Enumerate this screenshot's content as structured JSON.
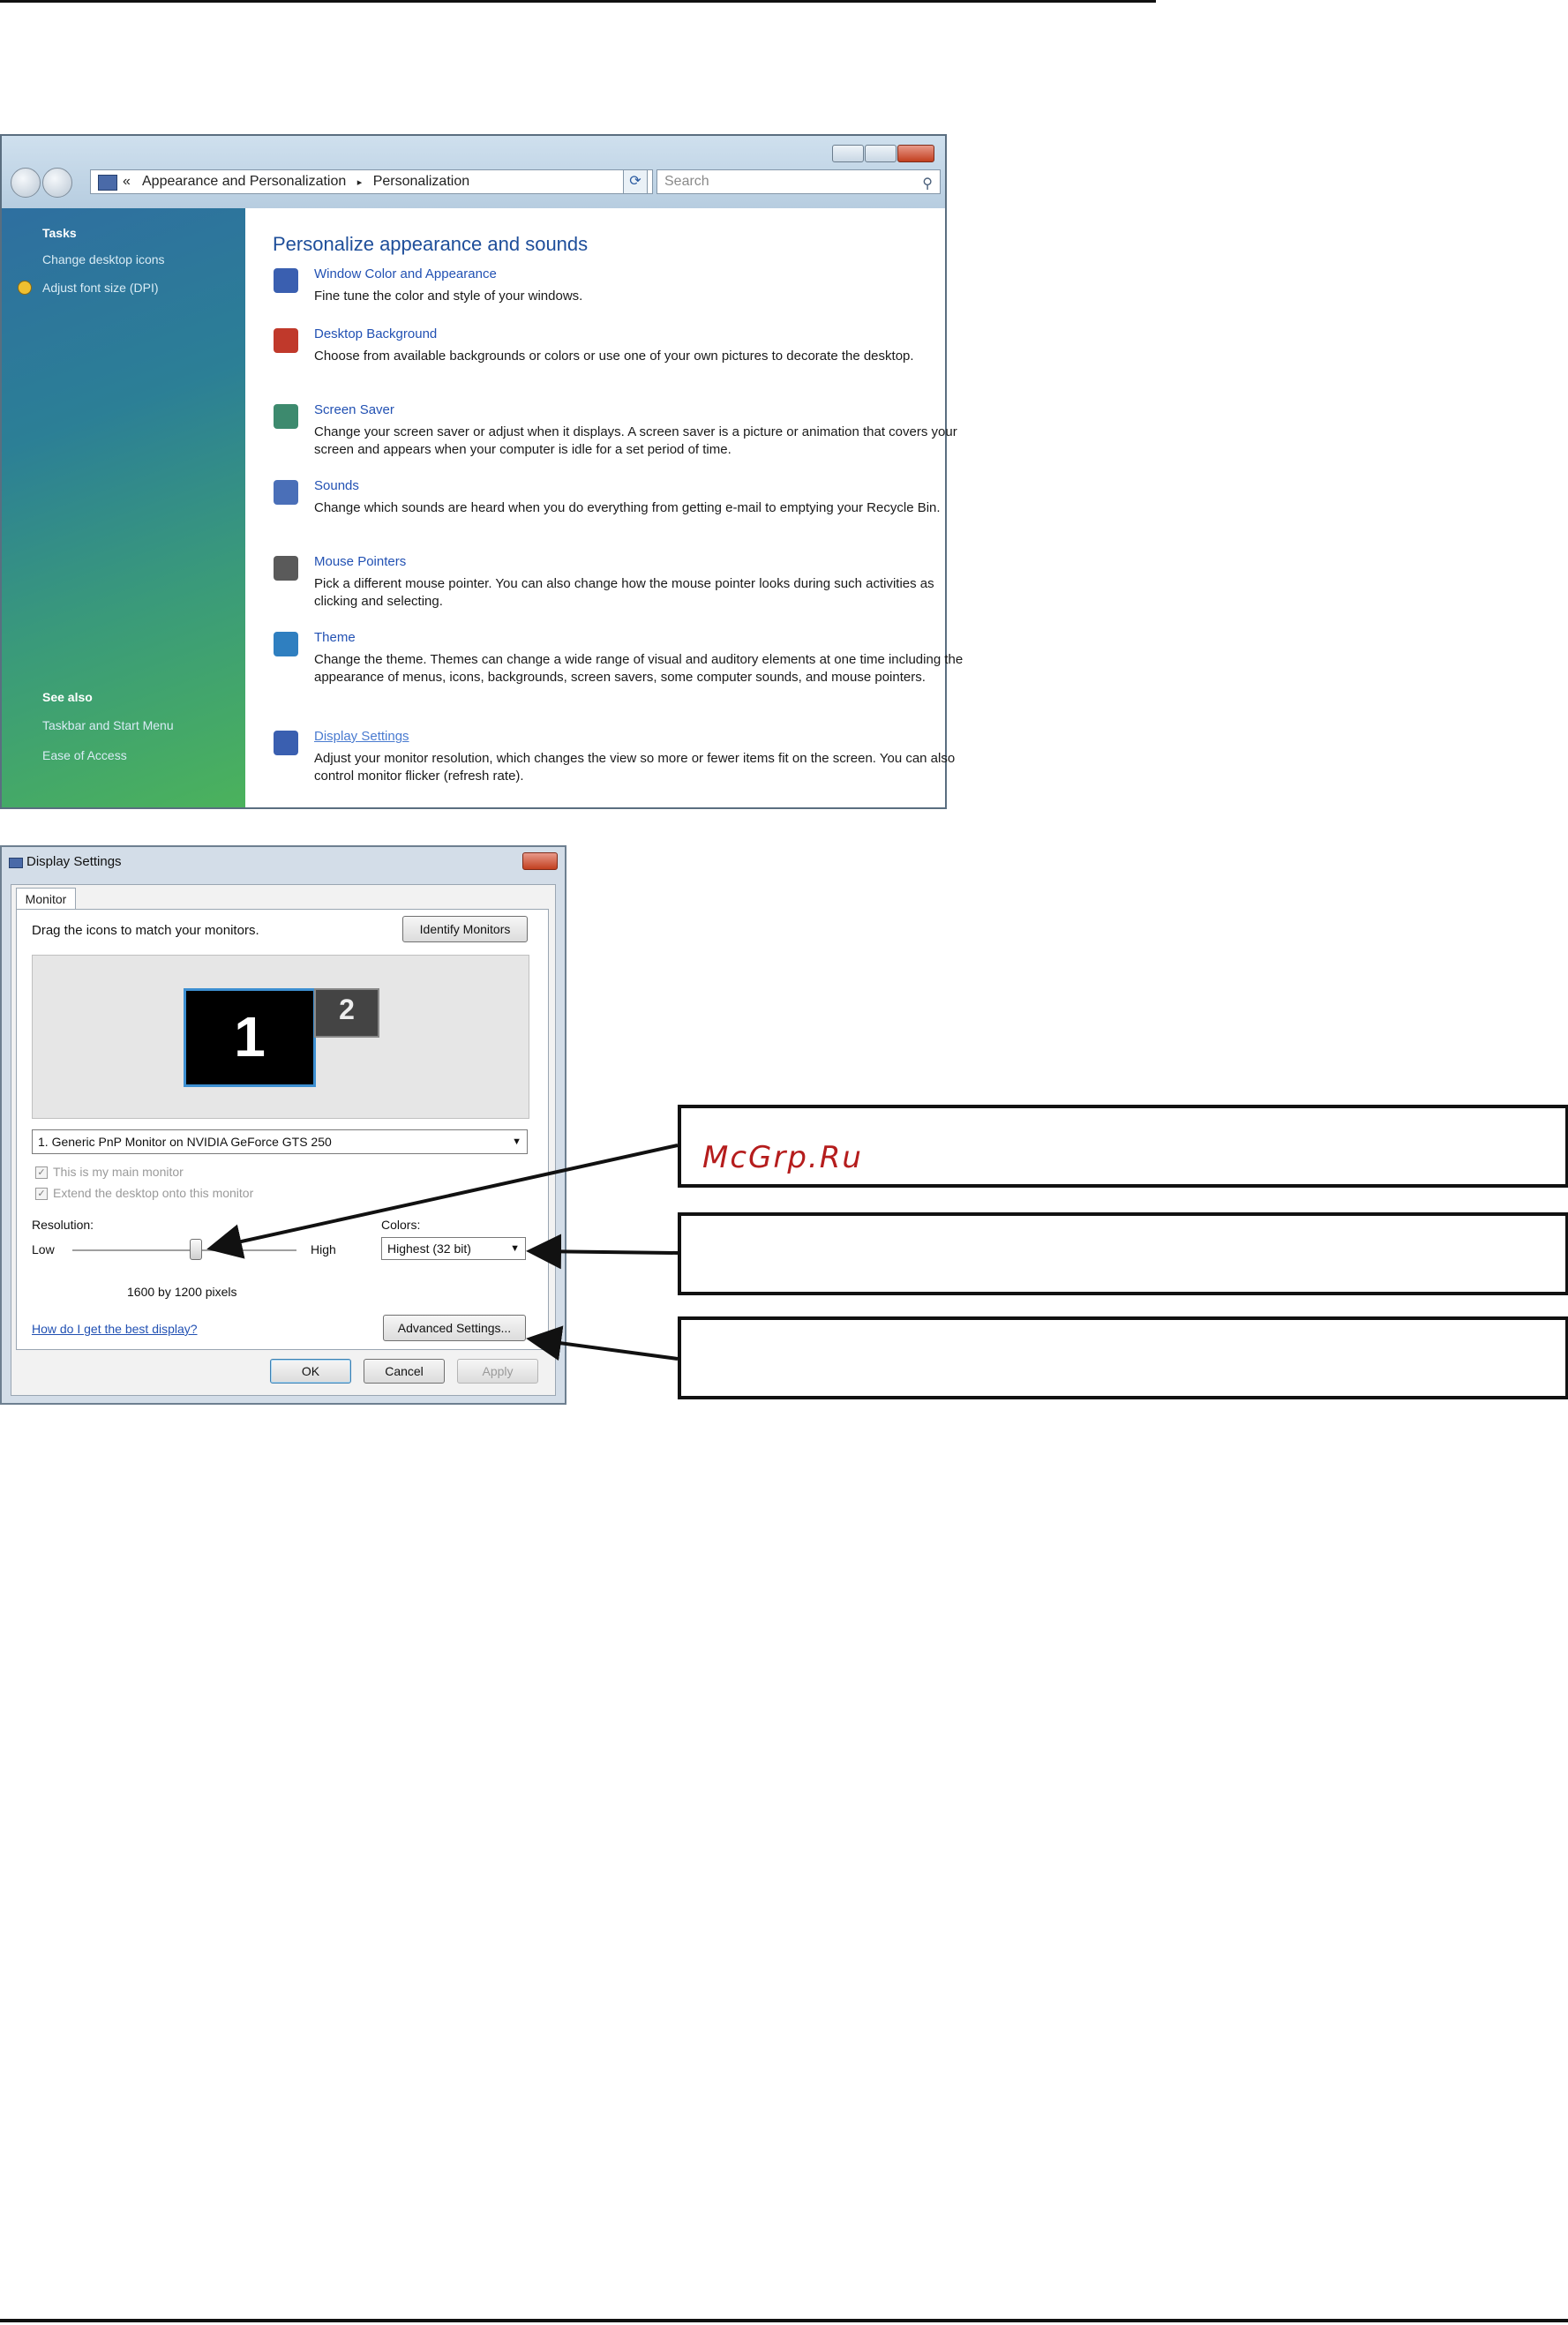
{
  "personalization_window": {
    "breadcrumb": {
      "prefix": "«",
      "parent": "Appearance and Personalization",
      "separator": "▸",
      "current": "Personalization"
    },
    "search_placeholder": "Search",
    "left_pane": {
      "tasks_heading": "Tasks",
      "tasks": [
        "Change desktop icons",
        "Adjust font size (DPI)"
      ],
      "see_also_heading": "See also",
      "see_also": [
        "Taskbar and Start Menu",
        "Ease of Access"
      ]
    },
    "main_title": "Personalize appearance and sounds",
    "items": [
      {
        "title": "Window Color and Appearance",
        "desc": "Fine tune the color and style of your windows."
      },
      {
        "title": "Desktop Background",
        "desc": "Choose from available backgrounds or colors or use one of your own pictures to decorate the desktop."
      },
      {
        "title": "Screen Saver",
        "desc": "Change your screen saver or adjust when it displays. A screen saver is a picture or animation that covers your screen and appears when your computer is idle for a set period of time."
      },
      {
        "title": "Sounds",
        "desc": "Change which sounds are heard when you do everything from getting e-mail to emptying your Recycle Bin."
      },
      {
        "title": "Mouse Pointers",
        "desc": "Pick a different mouse pointer. You can also change how the mouse pointer looks during such activities as clicking and selecting."
      },
      {
        "title": "Theme",
        "desc": "Change the theme. Themes can change a wide range of visual and auditory elements at one time including the appearance of menus, icons, backgrounds, screen savers, some computer sounds, and mouse pointers."
      },
      {
        "title": "Display Settings",
        "desc": "Adjust your monitor resolution, which changes the view so more or fewer items fit on the screen. You can also control monitor flicker (refresh rate)."
      }
    ],
    "icon_colors": [
      "#3a5fb0",
      "#c0392b",
      "#3d8a6e",
      "#4a6fb8",
      "#5a5a5a",
      "#2f7fc0",
      "#3a5fb0"
    ]
  },
  "display_settings": {
    "title": "Display Settings",
    "tab": "Monitor",
    "instruction": "Drag the icons to match your monitors.",
    "identify_button": "Identify Monitors",
    "monitor_1": "1",
    "monitor_2": "2",
    "monitor_select": "1. Generic PnP Monitor on NVIDIA GeForce GTS 250",
    "checkbox_main": "This is my main monitor",
    "checkbox_extend": "Extend the desktop onto this monitor",
    "resolution_label": "Resolution:",
    "low_label": "Low",
    "high_label": "High",
    "resolution_value": "1600 by 1200 pixels",
    "resolution_slider_position": 0.55,
    "colors_label": "Colors:",
    "colors_value": "Highest (32 bit)",
    "help_link": "How do I get the best display?",
    "advanced_button": "Advanced Settings...",
    "ok_button": "OK",
    "cancel_button": "Cancel",
    "apply_button": "Apply"
  },
  "watermark": "McGrp.Ru"
}
